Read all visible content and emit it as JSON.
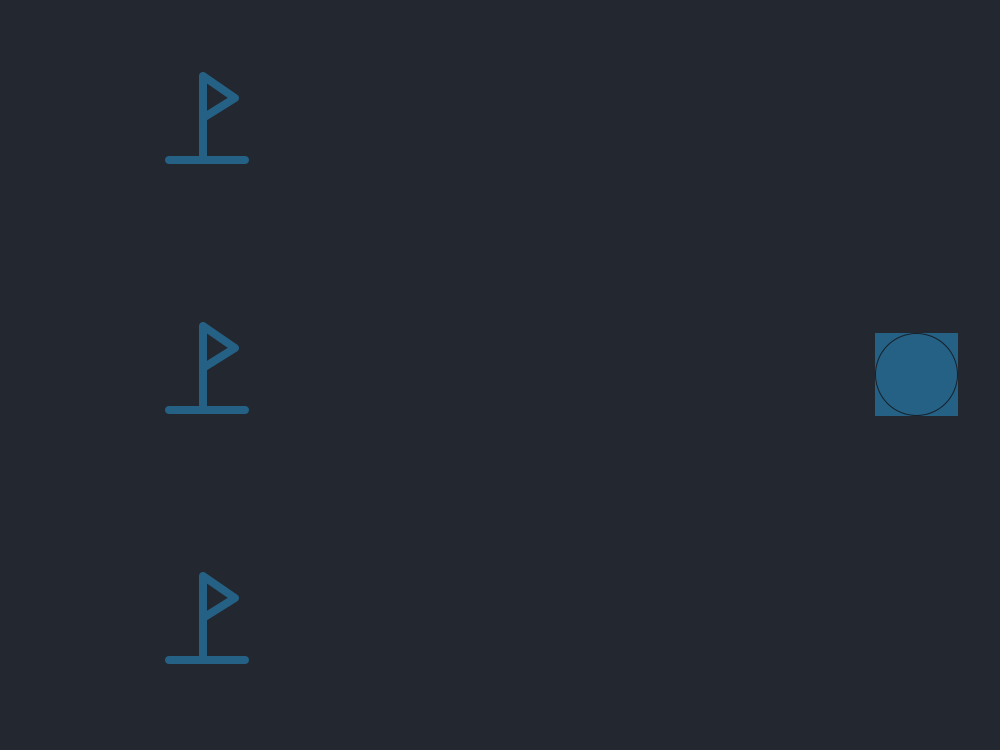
{
  "colors": {
    "background": "#23272f",
    "accent": "#256185",
    "ball_outline": "#16202a"
  },
  "board": {
    "flags": [
      {
        "icon": "golf-flag-icon"
      },
      {
        "icon": "golf-flag-icon"
      },
      {
        "icon": "golf-flag-icon"
      }
    ],
    "ball": {
      "icon": "ball-icon"
    }
  }
}
